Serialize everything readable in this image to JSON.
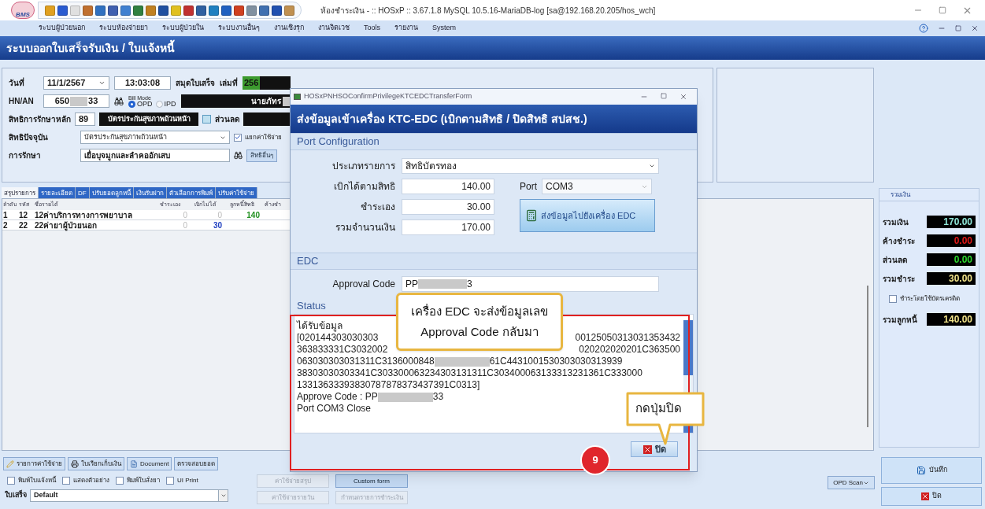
{
  "window": {
    "logo": "BMS",
    "title": "ห้องชำระเงิน - :: HOSxP :: 3.67.1.8 MySQL 10.5.16-MariaDB-log [sa@192.168.20.205/hos_wch]"
  },
  "menu": [
    "ระบบผู้ป่วยนอก",
    "ระบบห้องจ่ายยา",
    "ระบบผู้ป่วยใน",
    "ระบบงานอื่นๆ",
    "งานเชิงรุก",
    "งานจิตเวช",
    "Tools",
    "รายงาน",
    "System"
  ],
  "page_title": "ระบบออกใบเสร็จรับเงิน / ใบแจ้งหนี้",
  "form": {
    "date_label": "วันที่",
    "date": "11/1/2567",
    "time": "13:03:08",
    "receipt_book_label": "สมุดใบเสร็จ",
    "volume_label": "เล่มที่",
    "volume": "256",
    "hn_label": "HN/AN",
    "hn_start": "650",
    "hn_end": "33",
    "bill_mode_label": "Bill Mode",
    "bill_modes": [
      {
        "label": "OPD",
        "selected": true
      },
      {
        "label": "IPD",
        "selected": false
      }
    ],
    "patient_name": "นายภัทร",
    "main_right_label": "สิทธิการรักษาหลัก",
    "main_right_code": "89",
    "main_right_name": "บัตรประกันสุขภาพถ้วนหน้า",
    "discount_label": "ส่วนลด",
    "current_right_label": "สิทธิปัจจุบัน",
    "current_right": "บัตรประกันสุขภาพถ้วนหน้า",
    "split_expense": {
      "label": "แยกค่าใช้จ่าย",
      "checked": true
    },
    "treatment_label": "การรักษา",
    "treatment": "เยื่อบุจมูกและลำคออักเสบ",
    "other_rights_button": "สิทธิอื่นๆ"
  },
  "tabs": [
    {
      "label": "สรุปรายการ",
      "selected": true
    },
    {
      "label": "รายละเอียด",
      "selected": false
    },
    {
      "label": "DF",
      "selected": false
    },
    {
      "label": "ปรับยอดลูกหนี้",
      "selected": false
    },
    {
      "label": "เงินรับฝาก",
      "selected": false
    },
    {
      "label": "ตัวเลือกการพิมพ์",
      "selected": false
    },
    {
      "label": "ปรับค่าใช้จ่าย",
      "selected": false
    }
  ],
  "table": {
    "columns": [
      "ลำดับ",
      "รหัส",
      "ชื่อรายได้",
      "ชำระเอง",
      "เบิกไม่ได้",
      "ลูกหนี้สิทธิ",
      "ค้างชำ"
    ],
    "rows": [
      [
        "1",
        "12",
        "12ค่าบริการทางการพยาบาล",
        "0",
        "0",
        "140",
        ""
      ],
      [
        "2",
        "22",
        "22ค่ายาผู้ป่วยนอก",
        "0",
        "30",
        "",
        ""
      ]
    ]
  },
  "summary": {
    "title": "รวมเงิน",
    "rows": [
      {
        "label": "รวมเงิน",
        "value": "170.00",
        "color": "#8fe6d8"
      },
      {
        "label": "ค้างชำระ",
        "value": "0.00",
        "color": "#e01818"
      },
      {
        "label": "ส่วนลด",
        "value": "0.00",
        "color": "#2ed82e"
      },
      {
        "label": "รวมชำระ",
        "value": "30.00",
        "color": "#f2e48a"
      }
    ],
    "credit_card": {
      "label": "ชำระโดยใช้บัตรเครดิต",
      "checked": false
    },
    "debtor": {
      "label": "รวมลูกหนี้",
      "value": "140.00",
      "color": "#f2e48a"
    }
  },
  "bottom": {
    "action_buttons": [
      "รายการค่าใช้จ่าย",
      "ใบเรียกเก็บเงิน",
      "Document",
      "ตรวจสอบยอด"
    ],
    "print_options": [
      {
        "label": "พิมพ์ใบแจ้งหนี้",
        "checked": false
      },
      {
        "label": "แสดงตัวอย่าง",
        "checked": false
      },
      {
        "label": "พิมพ์ใบสั่งยา",
        "checked": false
      },
      {
        "label": "UI Print",
        "checked": false
      }
    ],
    "receipt_label": "ใบเสร็จ",
    "receipt_form": "Default",
    "form_buttons": [
      {
        "label": "ค่าใช้จ่ายสรุป",
        "disabled": true
      },
      {
        "label": "Custom form",
        "disabled": false
      },
      {
        "label": "ค่าใช้จ่ายรายวัน",
        "disabled": true
      },
      {
        "label": "กำหนดรายการชำระเงิน",
        "disabled": true
      }
    ],
    "opd_scan": "OPD Scan",
    "save": "บันทึก",
    "close": "ปิด"
  },
  "dialog": {
    "title": "HOSxPNHSOConfirmPrivilegeKTCEDCTransferForm",
    "heading": "ส่งข้อมูลเข้าเครื่อง KTC-EDC (เบิกตามสิทธิ / ปิดสิทธิ สปสช.)",
    "port_section": "Port Configuration",
    "type_label": "ประเภทรายการ",
    "type_value": "สิทธิบัตรทอง",
    "amounts": [
      {
        "label": "เบิกได้ตามสิทธิ",
        "value": "140.00"
      },
      {
        "label": "ชำระเอง",
        "value": "30.00"
      },
      {
        "label": "รวมจำนวนเงิน",
        "value": "170.00"
      }
    ],
    "port_label": "Port",
    "port_value": "COM3",
    "send_button": "ส่งข้อมูลไปยังเครื่อง EDC",
    "edc_section": "EDC",
    "approval_label": "Approval Code",
    "approval_start": "PP",
    "approval_end": "3",
    "status_section": "Status",
    "status_lines": [
      [
        {
          "kind": "text",
          "text": "ได้รับข้อมูล"
        }
      ],
      [
        {
          "kind": "text",
          "text": "[020144303030303"
        },
        {
          "kind": "covered"
        },
        {
          "kind": "text",
          "text": "00125050313031353432"
        }
      ],
      [
        {
          "kind": "text",
          "text": "363833331C3032002"
        },
        {
          "kind": "covered"
        },
        {
          "kind": "text",
          "text": "020202020201C363500"
        }
      ],
      [
        {
          "kind": "text",
          "text": "063030303031311C3136000848"
        },
        {
          "kind": "blurred"
        },
        {
          "kind": "text",
          "text": "61C4431001530303030313939"
        }
      ],
      [
        {
          "kind": "text",
          "text": "38303030303341C303300063234303131311C303400063133313231361C333000"
        }
      ],
      [
        {
          "kind": "text",
          "text": "13313633393830787878373437391C0313]"
        }
      ],
      [
        {
          "kind": "text",
          "text": "Approve Code : PP"
        },
        {
          "kind": "blurred"
        },
        {
          "kind": "text",
          "text": "33"
        }
      ],
      [
        {
          "kind": "text",
          "text": "Port COM3 Close"
        }
      ]
    ],
    "close_button": "ปิด"
  },
  "annotations": {
    "callout_lines": [
      "เครื่อง EDC จะส่งข้อมูลเลข",
      "Approval Code กลับมา"
    ],
    "close_callout": "กดปุ่มปิด",
    "step": "9"
  }
}
